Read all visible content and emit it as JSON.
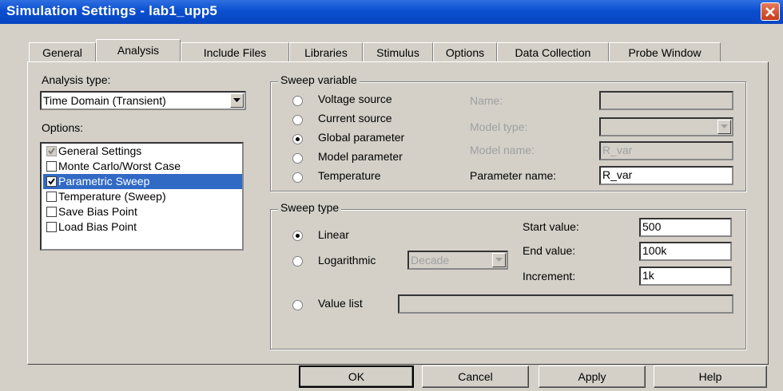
{
  "window": {
    "title": "Simulation Settings - lab1_upp5"
  },
  "tabs": [
    {
      "label": "General"
    },
    {
      "label": "Analysis"
    },
    {
      "label": "Include Files"
    },
    {
      "label": "Libraries"
    },
    {
      "label": "Stimulus"
    },
    {
      "label": "Options"
    },
    {
      "label": "Data Collection"
    },
    {
      "label": "Probe Window"
    }
  ],
  "active_tab": "Analysis",
  "analysis_type": {
    "label": "Analysis type:",
    "value": "Time Domain (Transient)"
  },
  "options": {
    "label": "Options:",
    "items": [
      {
        "label": "General Settings",
        "checked": true,
        "disabled": true,
        "selected": false
      },
      {
        "label": "Monte Carlo/Worst Case",
        "checked": false,
        "selected": false
      },
      {
        "label": "Parametric Sweep",
        "checked": true,
        "selected": true
      },
      {
        "label": "Temperature (Sweep)",
        "checked": false,
        "selected": false
      },
      {
        "label": "Save Bias Point",
        "checked": false,
        "selected": false
      },
      {
        "label": "Load Bias Point",
        "checked": false,
        "selected": false
      }
    ]
  },
  "sweep_variable": {
    "title": "Sweep variable",
    "options": [
      {
        "label": "Voltage source",
        "selected": false
      },
      {
        "label": "Current source",
        "selected": false
      },
      {
        "label": "Global parameter",
        "selected": true
      },
      {
        "label": "Model parameter",
        "selected": false
      },
      {
        "label": "Temperature",
        "selected": false
      }
    ],
    "name_label": "Name:",
    "name_value": "",
    "model_type_label": "Model type:",
    "model_type_value": "",
    "model_name_label": "Model name:",
    "model_name_value": "R_var",
    "parameter_name_label": "Parameter name:",
    "parameter_name_value": "R_var"
  },
  "sweep_type": {
    "title": "Sweep type",
    "linear_label": "Linear",
    "logarithmic_label": "Logarithmic",
    "log_scale_value": "Decade",
    "value_list_label": "Value list",
    "value_list_value": "",
    "selected": "Linear",
    "start_label": "Start value:",
    "start_value": "500",
    "end_label": "End value:",
    "end_value": "100k",
    "increment_label": "Increment:",
    "increment_value": "1k"
  },
  "buttons": {
    "ok": "OK",
    "cancel": "Cancel",
    "apply": "Apply",
    "help": "Help"
  },
  "colors": {
    "title_bar": "#0a4fd0",
    "selection": "#316ac5",
    "dialog_bg": "#d4d0c8"
  }
}
